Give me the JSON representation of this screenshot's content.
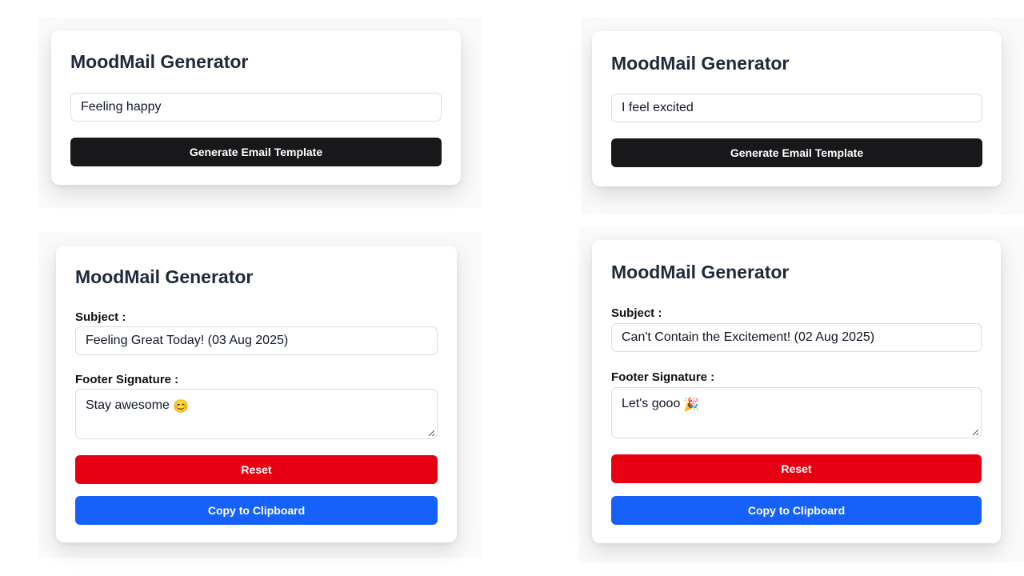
{
  "colors": {
    "generate_button": "#18181b",
    "reset_button": "#e60012",
    "copy_button": "#1661fa",
    "title_text": "#1e293b"
  },
  "panels": [
    {
      "title": "MoodMail Generator",
      "mood_input": "Feeling happy",
      "generate_label": "Generate Email Template"
    },
    {
      "title": "MoodMail Generator",
      "mood_input": "I feel excited",
      "generate_label": "Generate Email Template"
    },
    {
      "title": "MoodMail Generator",
      "subject_label": "Subject :",
      "subject_value": "Feeling Great Today! (03 Aug 2025)",
      "footer_label": "Footer Signature :",
      "footer_value": "Stay awesome",
      "footer_emoji": "😊",
      "reset_label": "Reset",
      "copy_label": "Copy to Clipboard"
    },
    {
      "title": "MoodMail Generator",
      "subject_label": "Subject :",
      "subject_value": "Can't Contain the Excitement! (02 Aug 2025)",
      "footer_label": "Footer Signature :",
      "footer_value": "Let's gooo",
      "footer_emoji": "🎉",
      "reset_label": "Reset",
      "copy_label": "Copy to Clipboard"
    }
  ]
}
